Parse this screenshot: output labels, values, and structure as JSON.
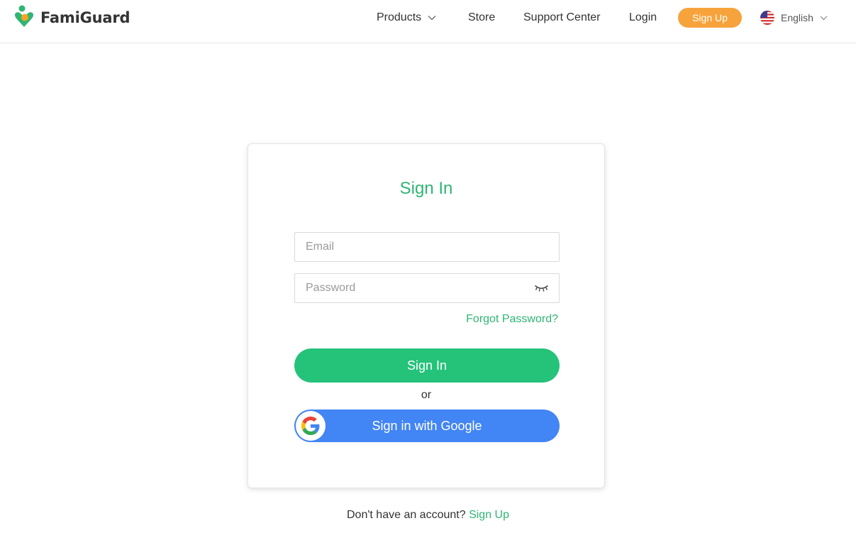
{
  "header": {
    "logo_text": "FamiGuard",
    "nav": {
      "products": "Products",
      "store": "Store",
      "support": "Support Center",
      "login": "Login"
    },
    "signup_label": "Sign Up",
    "language": "English",
    "icons": {
      "logo": "famiguard-logo-icon",
      "products_dropdown": "chevron-down-icon",
      "language_flag": "us-flag-icon",
      "language_dropdown": "chevron-down-icon"
    }
  },
  "signin": {
    "title": "Sign In",
    "email_placeholder": "Email",
    "email_value": "",
    "password_placeholder": "Password",
    "password_value": "",
    "password_toggle_icon": "eye-closed-icon",
    "forgot_label": "Forgot Password?",
    "submit_label": "Sign In",
    "or_label": "or",
    "google_label": "Sign in with Google",
    "google_icon": "google-g-icon"
  },
  "footer": {
    "prompt": "Don't have an account?",
    "signup_link": "Sign Up"
  },
  "colors": {
    "brand_green": "#2fb574",
    "signin_button": "#25c27a",
    "google_blue": "#4285f4",
    "signup_orange": "#f7a33c",
    "logo_orange": "#f5a623"
  }
}
